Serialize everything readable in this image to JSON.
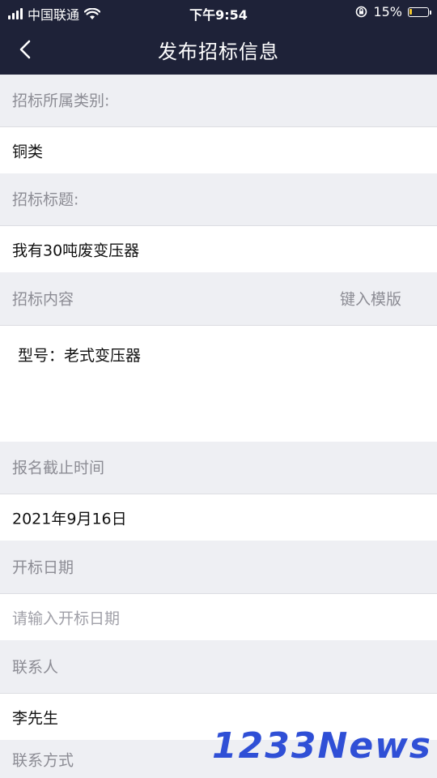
{
  "status_bar": {
    "carrier": "中国联通",
    "time": "下午9:54",
    "battery_percent": "15%",
    "battery_level": 0.15,
    "battery_color": "#f0c52a"
  },
  "nav": {
    "back_icon": "chevron-left-icon",
    "title": "发布招标信息"
  },
  "form": {
    "category_label": "招标所属类别:",
    "category_value": "铜类",
    "title_label": "招标标题:",
    "title_value": "我有30吨废变压器",
    "content_label": "招标内容",
    "template_button": "键入模版",
    "content_value": "型号：老式变压器",
    "deadline_label": "报名截止时间",
    "deadline_value": "2021年9月16日",
    "open_date_label": "开标日期",
    "open_date_placeholder": "请输入开标日期",
    "contact_label": "联系人",
    "contact_value": "李先生",
    "contact_method_label": "联系方式"
  },
  "watermark": "1233News",
  "colors": {
    "header_bg": "#1e2238",
    "page_bg": "#eeeff3",
    "label_text": "#8c8c94",
    "watermark": "#2f4fd6"
  }
}
